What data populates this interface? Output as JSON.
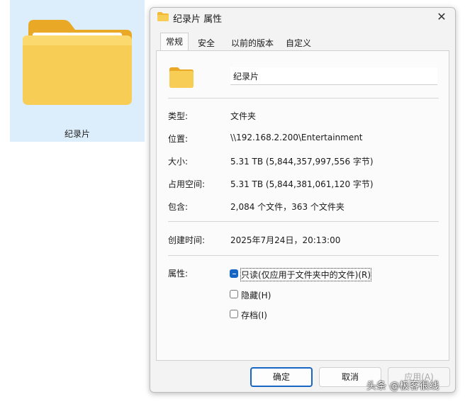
{
  "explorer": {
    "folder_label": "纪录片"
  },
  "dialog": {
    "title": "纪录片 属性",
    "close_glyph": "✕",
    "tabs": [
      "常规",
      "安全",
      "以前的版本",
      "自定义"
    ],
    "name_value": "纪录片",
    "properties": {
      "type_label": "类型:",
      "type_value": "文件夹",
      "location_label": "位置:",
      "location_value": "\\\\192.168.2.200\\Entertainment",
      "size_label": "大小:",
      "size_value": "5.31 TB (5,844,357,997,556 字节)",
      "disk_label": "占用空间:",
      "disk_value": "5.31 TB (5,844,381,061,120 字节)",
      "contains_label": "包含:",
      "contains_value": "2,084 个文件，363 个文件夹",
      "created_label": "创建时间:",
      "created_value": "2025年7月24日，20:13:00"
    },
    "attributes": {
      "label": "属性:",
      "readonly": "只读(仅应用于文件夹中的文件)(R)",
      "readonly_state": "indeterminate",
      "hidden": "隐藏(H)",
      "archive": "存档(I)"
    },
    "buttons": {
      "ok": "确定",
      "cancel": "取消",
      "apply": "应用(A)"
    }
  },
  "watermark": "头条 @极客很线",
  "colors": {
    "accent": "#1766c4",
    "folder": "#f7c948",
    "tile_selected": "#dceefb"
  }
}
